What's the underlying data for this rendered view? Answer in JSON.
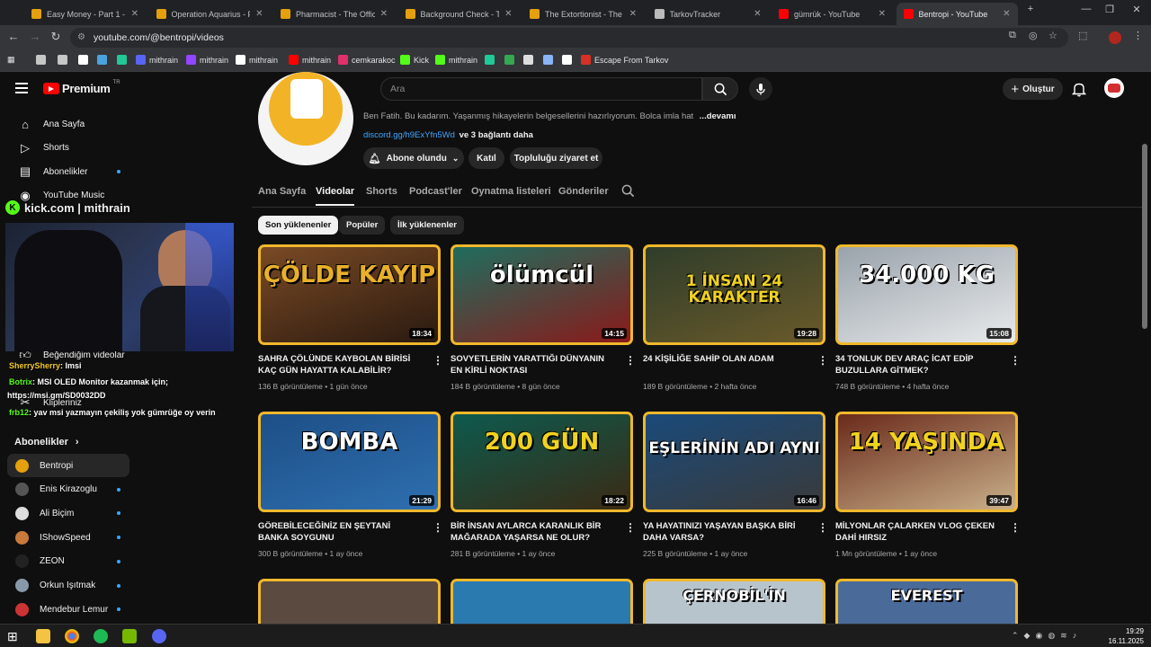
{
  "browser": {
    "tabs": [
      {
        "title": "Easy Money - Part 1 - The",
        "color": "#e5a00d"
      },
      {
        "title": "Operation Aquarius - Part",
        "color": "#e5a00d"
      },
      {
        "title": "Pharmacist - The Official ",
        "color": "#e5a00d"
      },
      {
        "title": "Background Check - The",
        "color": "#e5a00d"
      },
      {
        "title": "The Extortionist - The Offi",
        "color": "#e5a00d"
      },
      {
        "title": "TarkovTracker",
        "color": "#bbbbbb"
      },
      {
        "title": "gümrük - YouTube",
        "color": "#ff0000"
      },
      {
        "title": "Bentropi - YouTube",
        "color": "#ff0000"
      }
    ],
    "url": "youtube.com/@bentropi/videos",
    "bookmarks": [
      {
        "label": "",
        "color": "#c4c7c5"
      },
      {
        "label": "",
        "color": "#c4c7c5"
      },
      {
        "label": "",
        "color": "#ffffff"
      },
      {
        "label": "",
        "color": "#4aa3df"
      },
      {
        "label": "",
        "color": "#20c997"
      },
      {
        "label": "mithrain",
        "color": "#5865f2"
      },
      {
        "label": "mithrain",
        "color": "#9146ff"
      },
      {
        "label": "mithrain",
        "color": "#ffffff"
      },
      {
        "label": "mithrain",
        "color": "#ff0000"
      },
      {
        "label": "cemkarakoc",
        "color": "#e1306c"
      },
      {
        "label": "Kick",
        "color": "#53fc18"
      },
      {
        "label": "mithrain",
        "color": "#53fc18"
      },
      {
        "label": "",
        "color": "#20c997"
      },
      {
        "label": "",
        "color": "#34a853"
      },
      {
        "label": "",
        "color": "#dddddd"
      },
      {
        "label": "",
        "color": "#8ab4f8"
      },
      {
        "label": "",
        "color": "#ffffff"
      },
      {
        "label": "Escape From Tarkov",
        "color": "#d93025"
      }
    ]
  },
  "youtube": {
    "logo_text": "Premium",
    "logo_badge": "TR",
    "search_placeholder": "Ara",
    "create_label": "Oluştur",
    "sidebar": {
      "main": [
        {
          "label": "Ana Sayfa",
          "icon": "home-icon"
        },
        {
          "label": "Shorts",
          "icon": "shorts-icon"
        },
        {
          "label": "Abonelikler",
          "icon": "subscriptions-icon"
        },
        {
          "label": "YouTube Music",
          "icon": "music-icon"
        }
      ],
      "you_items": [
        {
          "label": "Beğendiğim videolar"
        },
        {
          "label": "Klipleriniz"
        }
      ],
      "subscriptions_header": "Abonelikler",
      "subscriptions": [
        {
          "label": "Bentropi",
          "color": "#e5a00d",
          "selected": true,
          "dot": false
        },
        {
          "label": "Enis Kirazoglu",
          "color": "#555555",
          "selected": false,
          "dot": true
        },
        {
          "label": "Ali Biçim",
          "color": "#dddddd",
          "selected": false,
          "dot": true
        },
        {
          "label": "IShowSpeed",
          "color": "#c97a3a",
          "selected": false,
          "dot": true
        },
        {
          "label": "ZEON",
          "color": "#222222",
          "selected": false,
          "dot": true
        },
        {
          "label": "Orkun Işıtmak",
          "color": "#8899aa",
          "selected": false,
          "dot": true
        },
        {
          "label": "Mendebur Lemur",
          "color": "#cc3333",
          "selected": false,
          "dot": true
        }
      ]
    },
    "channel": {
      "description": "Ben Fatih. Bu kadarım. Yaşanmış hikayelerin belgesellerini hazırlıyorum. Bolca imla hat",
      "more_label": "...devamı",
      "link": "discord.gg/h9ExYfn5Wd",
      "link_suffix": "ve 3 bağlantı daha",
      "subscribed_label": "Abone olundu",
      "join_label": "Katıl",
      "visit_label": "Topluluğu ziyaret et",
      "tabs": [
        "Ana Sayfa",
        "Videolar",
        "Shorts",
        "Podcast'ler",
        "Oynatma listeleri",
        "Gönderiler"
      ],
      "active_tab": "Videolar",
      "chips": [
        "Son yüklenenler",
        "Popüler",
        "İlk yüklenenler"
      ]
    },
    "videos": [
      {
        "title": "SAHRA ÇÖLÜNDE KAYBOLAN BİRİSİ KAÇ GÜN HAYATTA KALABİLİR?",
        "views": "136 B görüntüleme",
        "age": "1 gün önce",
        "duration": "18:34",
        "overlay": "ÇÖLDE KAYIP",
        "bg": "#7a4a24",
        "bg2": "#2a1a10",
        "ovcolor": "#e8b02a"
      },
      {
        "title": "SOVYETLERİN YARATTIĞI DÜNYANIN EN KİRLİ NOKTASI",
        "views": "184 B görüntüleme",
        "age": "8 gün önce",
        "duration": "14:15",
        "overlay": "ölümcül",
        "bg": "#1f6d5e",
        "bg2": "#8a1a1a",
        "ovcolor": "#ffffff"
      },
      {
        "title": "24 KİŞİLİĞE SAHİP OLAN ADAM",
        "views": "189 B görüntüleme",
        "age": "2 hafta önce",
        "duration": "19:28",
        "overlay": "1 İNSAN 24 KARAKTER",
        "bg": "#2f3d2a",
        "bg2": "#6a5a2a",
        "ovcolor": "#f1d21f"
      },
      {
        "title": "34 TONLUK DEV ARAÇ İCAT EDİP BUZULLARA GİTMEK?",
        "views": "748 B görüntüleme",
        "age": "4 hafta önce",
        "duration": "15:08",
        "overlay": "34.000 KG",
        "bg": "#9aa3ab",
        "bg2": "#e8eaec",
        "ovcolor": "#ffffff"
      },
      {
        "title": "GÖREBİLECEĞİNİZ EN ŞEYTANİ BANKA SOYGUNU",
        "views": "300 B görüntüleme",
        "age": "1 ay önce",
        "duration": "21:29",
        "overlay": "BOMBA",
        "bg": "#1d4f86",
        "bg2": "#2e6fb0",
        "ovcolor": "#ffffff"
      },
      {
        "title": "BİR İNSAN AYLARCA KARANLIK BİR MAĞARADA YAŞARSA NE OLUR?",
        "views": "281 B görüntüleme",
        "age": "1 ay önce",
        "duration": "18:22",
        "overlay": "200 GÜN",
        "bg": "#0d5a4e",
        "bg2": "#3a2a14",
        "ovcolor": "#f1d21f"
      },
      {
        "title": "YA HAYATINIZI YAŞAYAN BAŞKA BİRİ DAHA VARSA?",
        "views": "225 B görüntüleme",
        "age": "1 ay önce",
        "duration": "16:46",
        "overlay": "EŞLERİNİN ADI AYNI",
        "bg": "#1a4a7a",
        "bg2": "#3a3a3a",
        "ovcolor": "#ffffff"
      },
      {
        "title": "MİLYONLAR ÇALARKEN VLOG ÇEKEN DAHİ HIRSIZ",
        "views": "1 Mn görüntüleme",
        "age": "1 ay önce",
        "duration": "39:47",
        "overlay": "14 YAŞINDA",
        "bg": "#6a2a1a",
        "bg2": "#c9b08a",
        "ovcolor": "#f1d21f"
      }
    ],
    "partial_row": [
      {
        "overlay": "",
        "bg": "#5a4a40"
      },
      {
        "overlay": "",
        "bg": "#2a7ab0"
      },
      {
        "overlay": "ÇERNOBİL'İN",
        "bg": "#b8c4cc"
      },
      {
        "overlay": "EVEREST",
        "bg": "#4a6a9a"
      }
    ]
  },
  "stream_overlay": {
    "kick_text": "kick.com | mithrain",
    "chat": [
      {
        "user": "SherrySherry",
        "msg": ": lmsi",
        "color": "#f0c929"
      },
      {
        "user": "Botrix",
        "msg": ": MSI OLED Monitor kazanmak için;",
        "color": "#53fc18"
      },
      {
        "user": "",
        "msg": "https://msi.gm/SD0032DD",
        "color": "#ffffff"
      },
      {
        "user": "frb12",
        "msg": ": yav msi yazmayın çekiliş yok gümrüğe oy verin",
        "color": "#53fc18"
      }
    ]
  },
  "taskbar": {
    "time": "19:29",
    "date": "16.11.2025"
  }
}
